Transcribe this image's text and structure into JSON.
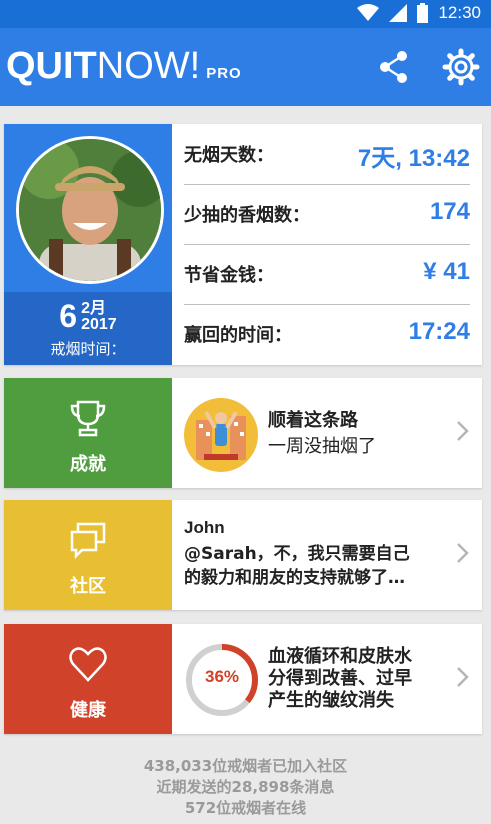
{
  "status_bar": {
    "time": "12:30"
  },
  "app_bar": {
    "logo_quit": "QUIT",
    "logo_now": "NOW!",
    "logo_pro": "PRO"
  },
  "profile": {
    "day": "6",
    "month": "2月",
    "year": "2017",
    "since_label": "戒烟时间："
  },
  "stats": [
    {
      "label": "无烟天数：",
      "value": "7天, 13:42"
    },
    {
      "label": "少抽的香烟数：",
      "value": "174"
    },
    {
      "label": "节省金钱：",
      "value": "¥ 41"
    },
    {
      "label": "赢回的时间：",
      "value": "17:24"
    }
  ],
  "achievements": {
    "tile_label": "成就",
    "line1": "顺着这条路",
    "line2": "一周没抽烟了"
  },
  "community": {
    "tile_label": "社区",
    "user": "John",
    "message_line1": "@Sarah，不，我只需要自己",
    "message_line2": "的毅力和朋友的支持就够了…"
  },
  "health": {
    "tile_label": "健康",
    "percent": "36%",
    "progress": 0.36,
    "line1": "血液循环和皮肤水",
    "line2": "分得到改善、过早",
    "line3": "产生的皱纹消失"
  },
  "footer": {
    "line1": "438,033位戒烟者已加入社区",
    "line2": "近期发送的28,898条消息",
    "line3": "572位戒烟者在线"
  },
  "colors": {
    "primary": "#2f7ee6",
    "achievement": "#4f9d3f",
    "community": "#e8be33",
    "health": "#d04229"
  }
}
